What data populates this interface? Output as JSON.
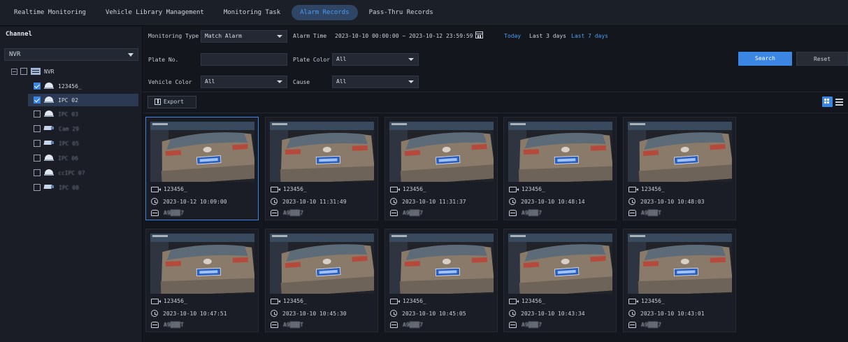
{
  "nav": {
    "tabs": [
      {
        "label": "Realtime Monitoring",
        "active": false
      },
      {
        "label": "Vehicle Library Management",
        "active": false
      },
      {
        "label": "Monitoring Task",
        "active": false
      },
      {
        "label": "Alarm Records",
        "active": true
      },
      {
        "label": "Pass-Thru Records",
        "active": false
      }
    ]
  },
  "sidebar": {
    "title": "Channel",
    "device_select": "NVR",
    "tree": [
      {
        "label": "NVR",
        "type": "nvr",
        "checked": false,
        "level": 0
      },
      {
        "label": "123456_",
        "type": "dome",
        "checked": true,
        "level": 1,
        "blurred": false
      },
      {
        "label": "IPC 02",
        "type": "dome",
        "checked": true,
        "level": 1,
        "blurred": false,
        "selected": true
      },
      {
        "label": "IPC 03",
        "type": "dome",
        "checked": false,
        "level": 1,
        "blurred": true
      },
      {
        "label": "Cam 29",
        "type": "bullet",
        "checked": false,
        "level": 1,
        "blurred": true
      },
      {
        "label": "IPC 05",
        "type": "bullet",
        "checked": false,
        "level": 1,
        "blurred": true
      },
      {
        "label": "IPC 06",
        "type": "dome",
        "checked": false,
        "level": 1,
        "blurred": true
      },
      {
        "label": "ccIPC 07",
        "type": "dome",
        "checked": false,
        "level": 1,
        "blurred": true
      },
      {
        "label": "IPC 08",
        "type": "bullet",
        "checked": false,
        "level": 1,
        "blurred": true
      }
    ]
  },
  "filters": {
    "monitoring_type_label": "Monitoring Type",
    "monitoring_type_value": "Match Alarm",
    "alarm_time_label": "Alarm Time",
    "alarm_time_value": "2023-10-10 00:00:00 ~ 2023-10-12 23:59:59",
    "quick_today": "Today",
    "quick_last3": "Last 3 days",
    "quick_last7": "Last 7 days",
    "plate_no_label": "Plate No.",
    "plate_no_value": "",
    "plate_color_label": "Plate Color",
    "plate_color_value": "All",
    "vehicle_color_label": "Vehicle Color",
    "vehicle_color_value": "All",
    "cause_label": "Cause",
    "cause_value": "All",
    "search_label": "Search",
    "reset_label": "Reset"
  },
  "toolbar": {
    "export_label": "Export"
  },
  "records": [
    {
      "channel": "123456_",
      "time": "2023-10-12 10:09:00",
      "plate": "A9▒▒▒7"
    },
    {
      "channel": "123456_",
      "time": "2023-10-10 11:31:49",
      "plate": "A9▒▒▒7"
    },
    {
      "channel": "123456_",
      "time": "2023-10-10 11:31:37",
      "plate": "A9▒▒▒7"
    },
    {
      "channel": "123456_",
      "time": "2023-10-10 10:48:14",
      "plate": "A9▒▒▒7"
    },
    {
      "channel": "123456_",
      "time": "2023-10-10 10:48:03",
      "plate": "A9▒▒▒T"
    },
    {
      "channel": "123456_",
      "time": "2023-10-10 10:47:51",
      "plate": "A9▒▒▒T"
    },
    {
      "channel": "123456_",
      "time": "2023-10-10 10:45:30",
      "plate": "A9▒▒▒T"
    },
    {
      "channel": "123456_",
      "time": "2023-10-10 10:45:05",
      "plate": "A9▒▒▒7"
    },
    {
      "channel": "123456_",
      "time": "2023-10-10 10:43:34",
      "plate": "A9▒▒▒7"
    },
    {
      "channel": "123456_",
      "time": "2023-10-10 10:43:01",
      "plate": "A9▒▒▒7"
    }
  ],
  "colors": {
    "accent": "#3b86e3",
    "active_tab_text": "#4e9cf2",
    "background": "#13161d",
    "panel": "#1a1d25"
  }
}
